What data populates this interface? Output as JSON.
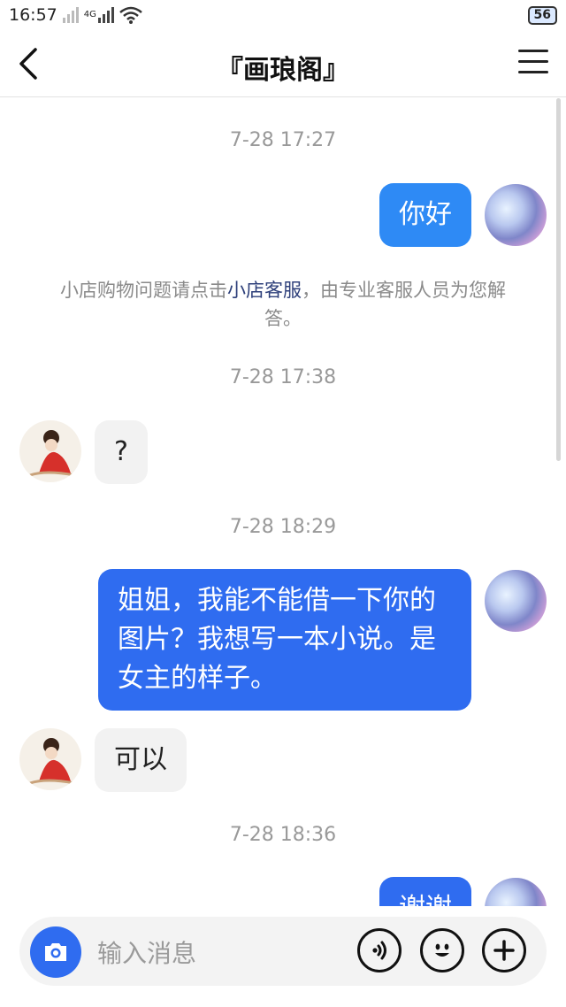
{
  "status_bar": {
    "time": "16:57",
    "network": "4G",
    "battery": "56"
  },
  "header": {
    "title": "『画琅阁』",
    "back_icon": "chevron-left-icon",
    "menu_icon": "hamburger-menu-icon"
  },
  "messages": [
    {
      "type": "timestamp",
      "text": "7-28 17:27"
    },
    {
      "type": "outgoing",
      "text": "你好"
    },
    {
      "type": "system",
      "prefix": "小店购物问题请点击",
      "link": "小店客服",
      "suffix": "，由专业客服人员为您解答。"
    },
    {
      "type": "timestamp",
      "text": "7-28 17:38"
    },
    {
      "type": "incoming",
      "text": "?"
    },
    {
      "type": "timestamp",
      "text": "7-28 18:29"
    },
    {
      "type": "outgoing",
      "text": "姐姐，我能不能借一下你的图片？我想写一本小说。是女主的样子。"
    },
    {
      "type": "incoming",
      "text": "可以"
    },
    {
      "type": "timestamp",
      "text": "7-28 18:36"
    },
    {
      "type": "outgoing",
      "text": "谢谢"
    }
  ],
  "input_bar": {
    "placeholder": "输入消息",
    "camera_icon": "camera-icon",
    "voice_icon": "voice-icon",
    "emoji_icon": "emoji-icon",
    "plus_icon": "plus-icon"
  },
  "colors": {
    "accent": "#2f6cf0",
    "link": "#2d3f7a",
    "timestamp": "#999999"
  }
}
